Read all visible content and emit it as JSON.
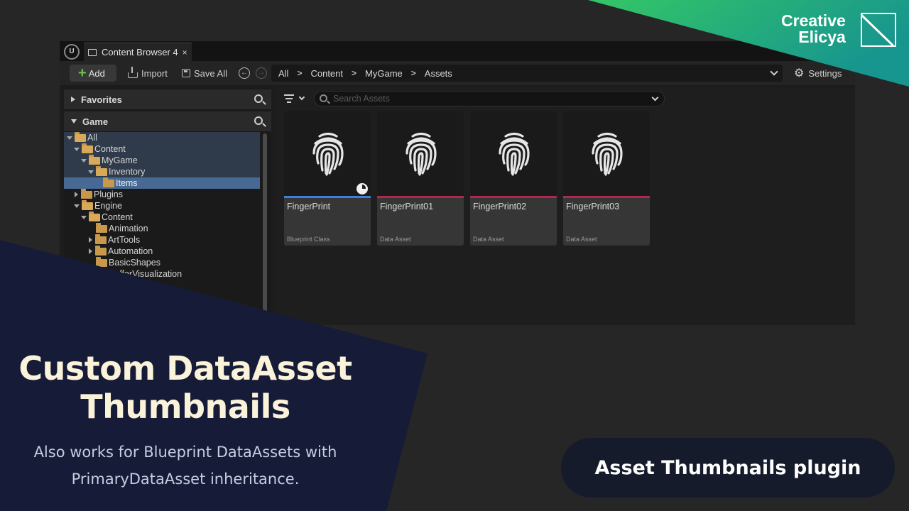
{
  "editor": {
    "tab": {
      "title": "Content Browser 4",
      "close": "×"
    },
    "toolbar": {
      "add_label": "Add",
      "import_label": "Import",
      "save_all_label": "Save All",
      "breadcrumb": [
        "All",
        "Content",
        "MyGame",
        "Assets"
      ],
      "breadcrumb_sep": ">",
      "settings_label": "Settings"
    },
    "left_panel": {
      "favorites_label": "Favorites",
      "game_label": "Game",
      "tree": [
        {
          "label": "All",
          "depth": 0,
          "caret": "down",
          "open": true,
          "state": "hl"
        },
        {
          "label": "Content",
          "depth": 1,
          "caret": "down",
          "open": true,
          "state": "hl"
        },
        {
          "label": "MyGame",
          "depth": 2,
          "caret": "down",
          "open": true,
          "state": "hl"
        },
        {
          "label": "Inventory",
          "depth": 3,
          "caret": "down",
          "open": true,
          "state": "hl"
        },
        {
          "label": "Items",
          "depth": 4,
          "caret": "none",
          "open": false,
          "state": "sel"
        },
        {
          "label": "Plugins",
          "depth": 1,
          "caret": "right",
          "open": false,
          "state": ""
        },
        {
          "label": "Engine",
          "depth": 1,
          "caret": "down",
          "open": true,
          "state": ""
        },
        {
          "label": "Content",
          "depth": 2,
          "caret": "down",
          "open": true,
          "state": ""
        },
        {
          "label": "Animation",
          "depth": 3,
          "caret": "none",
          "open": false,
          "state": ""
        },
        {
          "label": "ArtTools",
          "depth": 3,
          "caret": "right",
          "open": false,
          "state": ""
        },
        {
          "label": "Automation",
          "depth": 3,
          "caret": "right",
          "open": false,
          "state": ""
        },
        {
          "label": "BasicShapes",
          "depth": 3,
          "caret": "none",
          "open": false,
          "state": ""
        },
        {
          "label": "BufferVisualization",
          "depth": 3,
          "caret": "none",
          "open": false,
          "state": ""
        }
      ]
    },
    "search": {
      "placeholder": "Search Assets"
    },
    "assets": [
      {
        "name": "FingerPrint",
        "type": "Blueprint Class",
        "bar_color": "#3f7fdc",
        "badge": "pie-icon"
      },
      {
        "name": "FingerPrint01",
        "type": "Data Asset",
        "bar_color": "#b3264e",
        "badge": ""
      },
      {
        "name": "FingerPrint02",
        "type": "Data Asset",
        "bar_color": "#b3264e",
        "badge": ""
      },
      {
        "name": "FingerPrint03",
        "type": "Data Asset",
        "bar_color": "#b3264e",
        "badge": ""
      }
    ]
  },
  "brand": {
    "line1": "Creative",
    "line2": "Elicya"
  },
  "promo": {
    "title_line1": "Custom DataAsset",
    "title_line2": "Thumbnails",
    "sub_line1": "Also works for Blueprint DataAssets with",
    "sub_line2": "PrimaryDataAsset inheritance.",
    "plugin_label": "Asset Thumbnails plugin"
  },
  "colors": {
    "navy_panel": "#161b38",
    "teal_banner": "#1f9e8c",
    "green_banner": "#2fc46c",
    "title_cream": "#fbf3d9"
  }
}
